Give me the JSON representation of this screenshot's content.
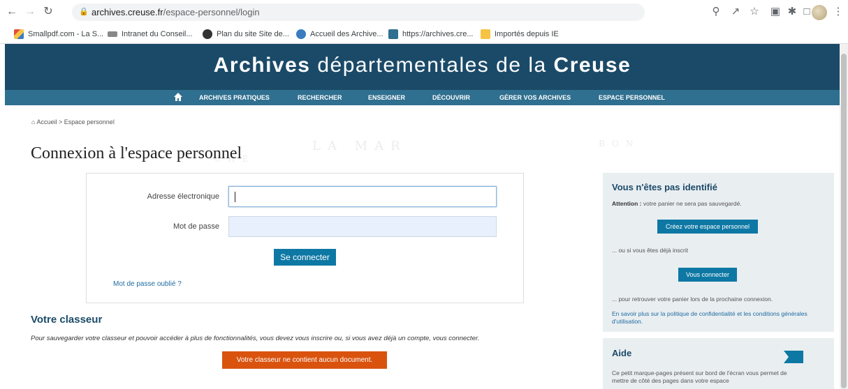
{
  "browser": {
    "url_host": "archives.creuse.fr",
    "url_path": "/espace-personnel/login",
    "bookmarks": [
      {
        "label": "Smallpdf.com - La S...",
        "color": "#e34d3b"
      },
      {
        "label": "Intranet du Conseil...",
        "color": "#6f6f6f"
      },
      {
        "label": "Plan du site Site de...",
        "color": "#333333"
      },
      {
        "label": "Accueil des Archive...",
        "color": "#3b7bbf"
      },
      {
        "label": "https://archives.cre...",
        "color": "#2f6f8f"
      },
      {
        "label": "Importés depuis IE",
        "color": "#f6c343"
      }
    ],
    "icons": [
      "back-icon",
      "forward-icon",
      "reload-icon",
      "lock-icon",
      "zoom-icon",
      "share-icon",
      "star-icon",
      "extension-icon",
      "puzzle-icon",
      "sidepanel-icon",
      "profile-avatar",
      "kebab-menu-icon"
    ]
  },
  "site": {
    "title_bold_1": "Archives",
    "title_mid": " départementales de la ",
    "title_bold_2": "Creuse",
    "menu": {
      "home_icon": "home-icon",
      "items": [
        "ARCHIVES PRATIQUES",
        "RECHERCHER",
        "ENSEIGNER",
        "DÉCOUVRIR",
        "GÉRER VOS ARCHIVES",
        "ESPACE PERSONNEL"
      ]
    },
    "breadcrumb": {
      "home": "Accueil",
      "separator": ">",
      "current": "Espace personnel"
    },
    "page_title": "Connexion à l'espace personnel",
    "login": {
      "email_label": "Adresse électronique",
      "email_value": "",
      "password_label": "Mot de passe",
      "password_value": "",
      "submit": "Se connecter",
      "forgot": "Mot de passe oublié ?"
    },
    "classeur": {
      "title": "Votre classeur",
      "text": "Pour sauvegarder votre classeur et pouvoir accéder à plus de fonctionnalités, vous devez vous inscrire ou, si vous avez déjà un compte, vous connecter.",
      "empty": "Votre classeur ne contient aucun document."
    },
    "sidebar": {
      "title": "Vous n'êtes pas identifié",
      "attention_bold": "Attention :",
      "attention_text": " votre panier ne sera pas sauvegardé.",
      "create_button": "Créez votre espace personnel",
      "or_text": "... ou si vous êtes déjà inscrit",
      "login_button": "Vous connecter",
      "retrieve_text": "... pour retrouver votre panier lors de la prochaine connexion.",
      "privacy_link": "En savoir plus sur la politique de confidentialité et les conditions générales d'utilisation."
    },
    "aide": {
      "title": "Aide",
      "text": "Ce petit marque-pages présent sur bord de l'écran vous permet de mettre de côté des pages dans votre espace"
    },
    "colors": {
      "banner": "#1b4a68",
      "menu": "#2f6f8f",
      "button_blue": "#0e78a4",
      "button_orange": "#d9530f"
    }
  }
}
